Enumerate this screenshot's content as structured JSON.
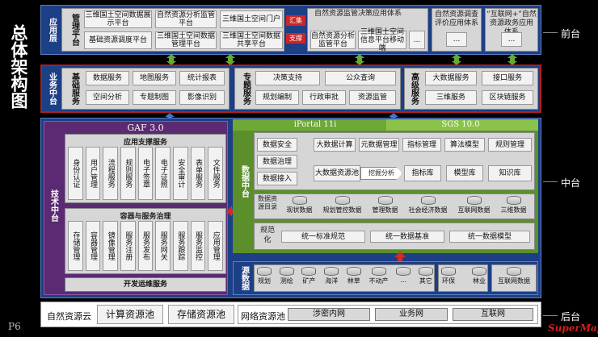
{
  "page": {
    "title": "总体架构图",
    "page_number": "P6",
    "watermark": "SuperMap"
  },
  "side": {
    "front": "前台",
    "middle": "中台",
    "back": "后台"
  },
  "app_layer": {
    "label": "应用层",
    "mgmt": "管理平台",
    "items": [
      "三维国土空间数据展示平台",
      "自然资源分析监管平台",
      "三维国土空间门户",
      "基础资源调度平台",
      "三维国土空间数据管理平台",
      "三维国土空间数据共享平台"
    ],
    "tag1": "汇集",
    "tag2": "支撑",
    "supervision": "自然资源监管决策应用体系",
    "sup_items": [
      "自然资源分析监管平台",
      "三维国土空间信息平台移动端"
    ],
    "ellipsis": "...",
    "survey": "自然资源调查评价应用体系",
    "internet": "“互联网+”自然资源政务应用体系"
  },
  "biz_layer": {
    "label": "业务中台",
    "base": "基础服务",
    "base_items": [
      "数据服务",
      "地图服务",
      "统计报表",
      "空间分析",
      "专题制图",
      "影像识别"
    ],
    "topic": "专题服务",
    "topic_items": [
      "决策支持",
      "公众查询",
      "规划编制",
      "行政审批",
      "资源监管"
    ],
    "adv": "高级服务",
    "adv_items": [
      "大数据服务",
      "接口服务",
      "三维服务",
      "区块链服务"
    ]
  },
  "tech": {
    "label": "技术中台",
    "gaf": "GAF 3.0",
    "support": "应用支撑服务",
    "support_items": [
      "身份认证",
      "用户管理",
      "流程服务",
      "规则服务",
      "电子签章",
      "电子证照",
      "安全审计",
      "表单服务",
      "文件服务"
    ],
    "container": "容器与服务治理",
    "container_items": [
      "存储管理",
      "容器管理",
      "镜像管理",
      "服务注册",
      "服务发布",
      "服务网关",
      "服务跟踪",
      "服务监控",
      "应用管理"
    ],
    "devops": "开发运维服务"
  },
  "data_mid": {
    "label": "数据中台",
    "iportal": "iPortal 11i",
    "sgs": "SGS 10.0",
    "gov": [
      "数据安全",
      "数据治理",
      "数据接入"
    ],
    "ops": [
      "大数据计算",
      "元数据管理",
      "指标管理",
      "算法模型",
      "规则管理"
    ],
    "big_data": "大数据资源池",
    "mining": "挖掘分析",
    "libs": [
      "指标库",
      "模型库",
      "知识库"
    ],
    "catalog_label": "数据资源目录",
    "catalog": [
      "现状数据",
      "规划管控数据",
      "管理数据",
      "社会经济数据",
      "互联网数据",
      "三维数据"
    ],
    "std_label": "规范化",
    "std": [
      "统一标准规范",
      "统一数据基准",
      "统一数据模型"
    ]
  },
  "sources": {
    "label": "源数据",
    "items": [
      "规划",
      "测绘",
      "矿产",
      "海洋",
      "林草",
      "不动产",
      "...",
      "其它"
    ],
    "extra": [
      "环保",
      "林业"
    ],
    "internet": "互联网数据"
  },
  "cloud": {
    "label": "自然资源云",
    "compute": "计算资源池",
    "storage": "存储资源池",
    "network": "网络资源池",
    "nets": [
      "涉密内网",
      "业务网",
      "互联网"
    ]
  }
}
